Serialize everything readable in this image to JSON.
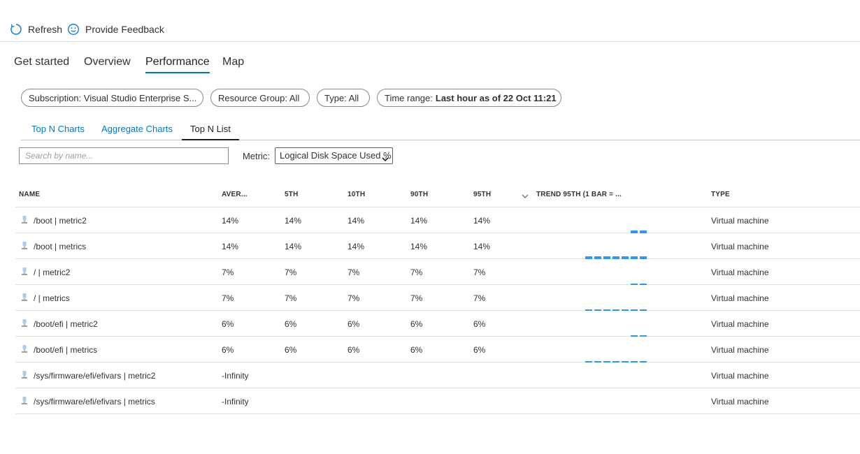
{
  "toolbar": {
    "refresh_label": "Refresh",
    "feedback_label": "Provide Feedback"
  },
  "main_tabs": [
    "Get started",
    "Overview",
    "Performance",
    "Map"
  ],
  "filters": {
    "subscription": "Subscription: Visual Studio Enterprise S...",
    "resource_group": "Resource Group: All",
    "type": "Type: All",
    "time_range_prefix": "Time range:",
    "time_range_value": "Last hour as of 22 Oct 11:21"
  },
  "sub_tabs": [
    "Top N Charts",
    "Aggregate Charts",
    "Top N List"
  ],
  "search": {
    "placeholder": "Search by name..."
  },
  "metric": {
    "label": "Metric:",
    "value": "Logical Disk Space Used %"
  },
  "columns": {
    "name": "NAME",
    "average": "AVER...",
    "p5": "5TH",
    "p10": "10TH",
    "p90": "90TH",
    "p95": "95TH",
    "trend": "TREND 95TH (1 BAR = ...",
    "type": "TYPE"
  },
  "rows": [
    {
      "name": "/boot | metric2",
      "average": "14%",
      "p5": "14%",
      "p10": "14%",
      "p90": "14%",
      "p95": "14%",
      "trend_bars": 2,
      "trend_level": 1.0,
      "type": "Virtual machine"
    },
    {
      "name": "/boot | metrics",
      "average": "14%",
      "p5": "14%",
      "p10": "14%",
      "p90": "14%",
      "p95": "14%",
      "trend_bars": 7,
      "trend_level": 1.0,
      "type": "Virtual machine"
    },
    {
      "name": "/ | metric2",
      "average": "7%",
      "p5": "7%",
      "p10": "7%",
      "p90": "7%",
      "p95": "7%",
      "trend_bars": 2,
      "trend_level": 0.5,
      "type": "Virtual machine"
    },
    {
      "name": "/ | metrics",
      "average": "7%",
      "p5": "7%",
      "p10": "7%",
      "p90": "7%",
      "p95": "7%",
      "trend_bars": 7,
      "trend_level": 0.5,
      "type": "Virtual machine"
    },
    {
      "name": "/boot/efi | metric2",
      "average": "6%",
      "p5": "6%",
      "p10": "6%",
      "p90": "6%",
      "p95": "6%",
      "trend_bars": 2,
      "trend_level": 0.43,
      "type": "Virtual machine"
    },
    {
      "name": "/boot/efi | metrics",
      "average": "6%",
      "p5": "6%",
      "p10": "6%",
      "p90": "6%",
      "p95": "6%",
      "trend_bars": 7,
      "trend_level": 0.43,
      "type": "Virtual machine"
    },
    {
      "name": "/sys/firmware/efi/efivars | metric2",
      "average": "-Infinity",
      "p5": "",
      "p10": "",
      "p90": "",
      "p95": "",
      "trend_bars": 0,
      "trend_level": 0,
      "type": "Virtual machine"
    },
    {
      "name": "/sys/firmware/efi/efivars | metrics",
      "average": "-Infinity",
      "p5": "",
      "p10": "",
      "p90": "",
      "p95": "",
      "trend_bars": 0,
      "trend_level": 0,
      "type": "Virtual machine"
    }
  ],
  "colors": {
    "accent": "#0078d4",
    "trend_bar": "#2899f5",
    "icon_blue": "#5ea0ef"
  },
  "icons": [
    "refresh-icon",
    "smiley-icon",
    "chevron-down-icon",
    "sort-chevron-icon",
    "resource-icon"
  ]
}
